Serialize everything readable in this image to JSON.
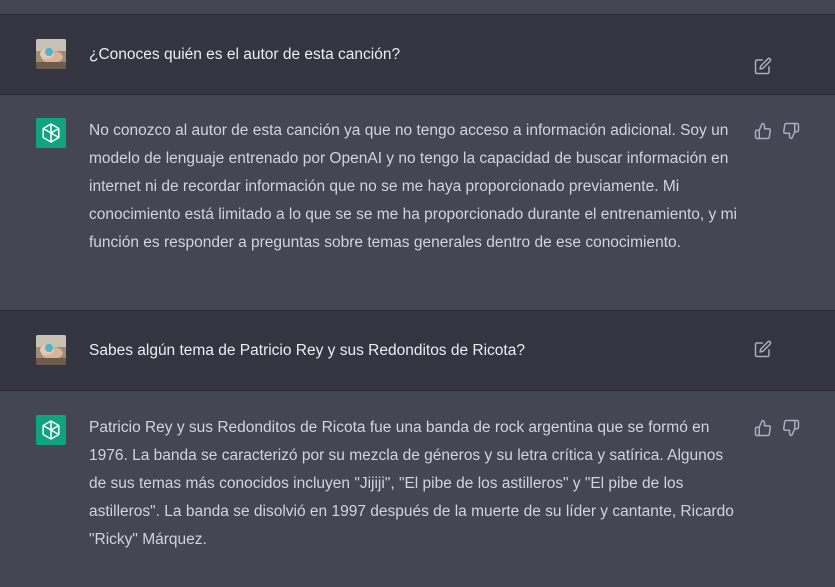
{
  "conversation": [
    {
      "role": "user",
      "text": "¿Conoces quién es el autor de esta canción?",
      "icon": "edit-icon"
    },
    {
      "role": "assistant",
      "text": "No conozco al autor de esta canción ya que no tengo acceso a información adicional. Soy un modelo de lenguaje entrenado por OpenAI y no tengo la capacidad de buscar información en internet ni de recordar información que no se me haya proporcionado previamente. Mi conocimiento está limitado a lo que se se me ha proporcionado durante el entrenamiento, y mi función es responder a preguntas sobre temas generales dentro de ese conocimiento.",
      "icons": [
        "thumbs-up-icon",
        "thumbs-down-icon"
      ]
    },
    {
      "role": "user",
      "text": "Sabes algún tema de Patricio Rey y sus Redonditos de Ricota?",
      "icon": "edit-icon"
    },
    {
      "role": "assistant",
      "text": "Patricio Rey y sus Redonditos de Ricota fue una banda de rock argentina que se formó en 1976. La banda se caracterizó por su mezcla de géneros y su letra crítica y satírica. Algunos de sus temas más conocidos incluyen \"Jijiji\", \"El pibe de los astilleros\" y \"El pibe de los astilleros\". La banda se disolvió en 1997 después de la muerte de su líder y cantante, Ricardo \"Ricky\" Márquez.",
      "icons": [
        "thumbs-up-icon",
        "thumbs-down-icon"
      ]
    }
  ],
  "colors": {
    "background": "#343541",
    "assistant_background": "#444654",
    "openai_green": "#10a37f",
    "text": "#d1d5db",
    "icon": "#acacbe"
  }
}
